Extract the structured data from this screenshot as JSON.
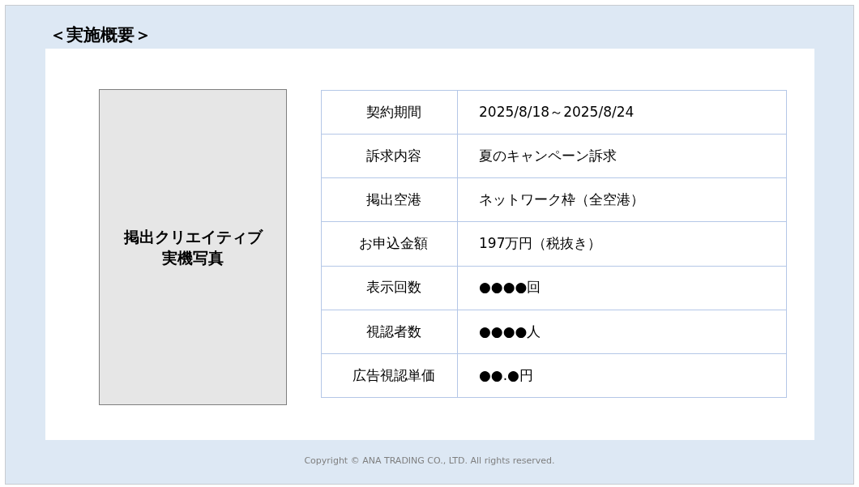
{
  "heading": "＜実施概要＞",
  "picture_placeholder": {
    "lines": [
      "掲出クリエイティブ",
      "実機写真"
    ]
  },
  "table": {
    "rows": [
      {
        "label": "契約期間",
        "value": "2025/8/18～2025/8/24"
      },
      {
        "label": "訴求内容",
        "value": "夏のキャンペーン訴求"
      },
      {
        "label": "掲出空港",
        "value": "ネットワーク枠（全空港）"
      },
      {
        "label": "お申込金額",
        "value": "197万円（税抜き）"
      },
      {
        "label": "表示回数",
        "value": "●●●●回"
      },
      {
        "label": "視認者数",
        "value": "●●●●人"
      },
      {
        "label": "広告視認単価",
        "value": "●●.●円"
      }
    ]
  },
  "footer": "Copyright © ANA TRADING CO., LTD. All rights reserved."
}
